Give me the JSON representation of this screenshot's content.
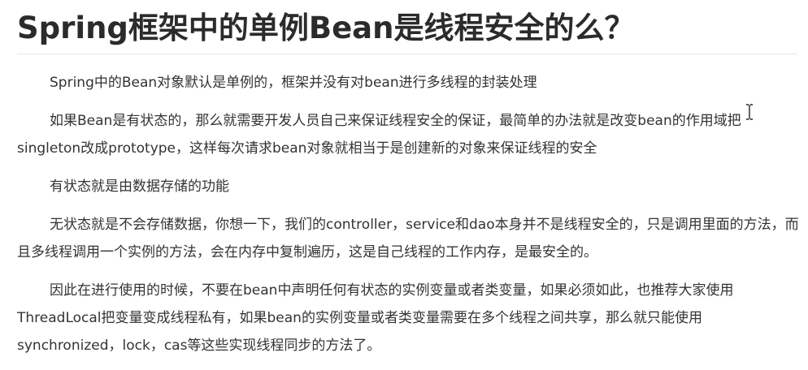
{
  "article": {
    "title": "Spring框架中的单例Bean是线程安全的么？",
    "paragraphs": [
      "Spring中的Bean对象默认是单例的，框架并没有对bean进行多线程的封装处理",
      "如果Bean是有状态的，那么就需要开发人员自己来保证线程安全的保证，最简单的办法就是改变bean的作用域把singleton改成prototype，这样每次请求bean对象就相当于是创建新的对象来保证线程的安全",
      "有状态就是由数据存储的功能",
      "无状态就是不会存储数据，你想一下，我们的controller，service和dao本身并不是线程安全的，只是调用里面的方法，而且多线程调用一个实例的方法，会在内存中复制遍历，这是自己线程的工作内存，是最安全的。",
      "因此在进行使用的时候，不要在bean中声明任何有状态的实例变量或者类变量，如果必须如此，也推荐大家使用ThreadLocal把变量变成线程私有，如果bean的实例变量或者类变量需要在多个线程之间共享，那么就只能使用synchronized，lock，cas等这些实现线程同步的方法了。"
    ]
  },
  "pointer": {
    "icon": "text-cursor-icon"
  }
}
